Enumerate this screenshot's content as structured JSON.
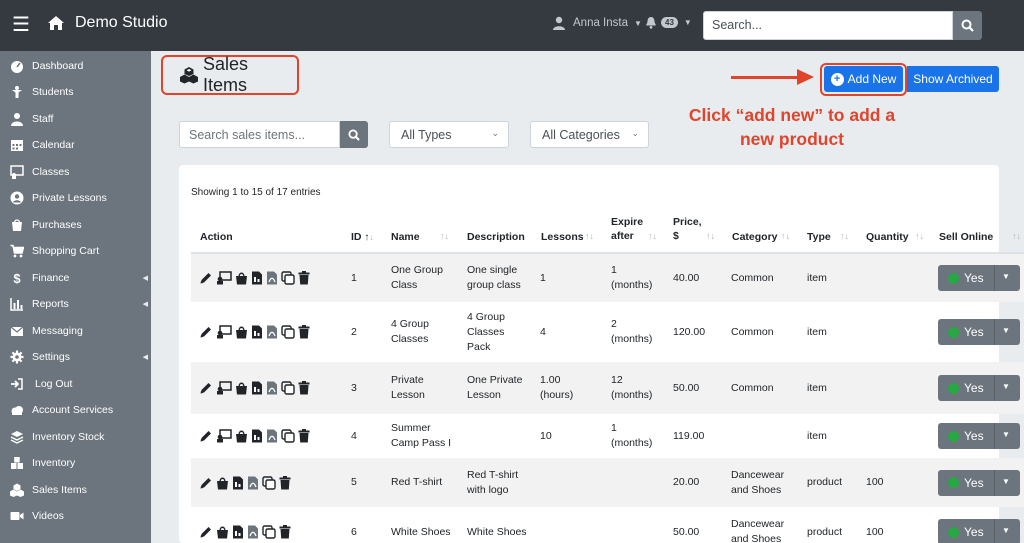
{
  "topbar": {
    "brand": "Demo Studio",
    "user_name": "Anna Insta",
    "notification_count": "43",
    "search_placeholder": "Search..."
  },
  "sidebar": {
    "items": [
      {
        "label": "Dashboard",
        "icon": "dashboard-icon"
      },
      {
        "label": "Students",
        "icon": "student-icon"
      },
      {
        "label": "Staff",
        "icon": "staff-icon"
      },
      {
        "label": "Calendar",
        "icon": "calendar-icon"
      },
      {
        "label": "Classes",
        "icon": "classes-icon"
      },
      {
        "label": "Private Lessons",
        "icon": "user-circle-icon"
      },
      {
        "label": "Purchases",
        "icon": "purchases-icon"
      },
      {
        "label": "Shopping Cart",
        "icon": "cart-icon"
      },
      {
        "label": "Finance",
        "icon": "dollar-icon"
      },
      {
        "label": "Reports",
        "icon": "reports-icon"
      },
      {
        "label": "Messaging",
        "icon": "envelope-icon"
      },
      {
        "label": "Settings",
        "icon": "gear-icon"
      },
      {
        "label": "Log Out",
        "icon": "logout-icon"
      },
      {
        "label": "Account Services",
        "icon": "cloud-icon"
      },
      {
        "label": "Inventory Stock",
        "icon": "layers-icon"
      },
      {
        "label": "Inventory",
        "icon": "inventory-icon"
      },
      {
        "label": "Sales Items",
        "icon": "cubes-icon"
      },
      {
        "label": "Videos",
        "icon": "video-icon"
      }
    ]
  },
  "page": {
    "title": "Sales Items",
    "add_new": "Add New",
    "show_archived": "Show Archived",
    "callout": "Click “add new” to add a new product",
    "search_placeholder": "Search sales items...",
    "type_select": "All Types",
    "category_select": "All Categories",
    "showing": "Showing 1 to 15 of 17 entries"
  },
  "table": {
    "headers": {
      "action": "Action",
      "id": "ID",
      "name": "Name",
      "description": "Description",
      "lessons": "Lessons",
      "expire_after": "Expire after",
      "price": "Price, $",
      "category": "Category",
      "type": "Type",
      "quantity": "Quantity",
      "sell_online": "Sell Online"
    },
    "rows": [
      {
        "id": "1",
        "name": "One Group Class",
        "description": "One single group class",
        "lessons": "1",
        "expire": "1 (months)",
        "price": "40.00",
        "category": "Common",
        "type": "item",
        "quantity": "",
        "sell": "Yes"
      },
      {
        "id": "2",
        "name": "4 Group Classes",
        "description": "4 Group Classes Pack",
        "lessons": "4",
        "expire": "2 (months)",
        "price": "120.00",
        "category": "Common",
        "type": "item",
        "quantity": "",
        "sell": "Yes"
      },
      {
        "id": "3",
        "name": "Private Lesson",
        "description": "One Private Lesson",
        "lessons": "1.00 (hours)",
        "expire": "12 (months)",
        "price": "50.00",
        "category": "Common",
        "type": "item",
        "quantity": "",
        "sell": "Yes"
      },
      {
        "id": "4",
        "name": "Summer Camp Pass I",
        "description": "",
        "lessons": "10",
        "expire": "1 (months)",
        "price": "119.00",
        "category": "",
        "type": "item",
        "quantity": "",
        "sell": "Yes"
      },
      {
        "id": "5",
        "name": "Red T-shirt",
        "description": "Red T-shirt with logo",
        "lessons": "",
        "expire": "",
        "price": "20.00",
        "category": "Dancewear and Shoes",
        "type": "product",
        "quantity": "100",
        "sell": "Yes"
      },
      {
        "id": "6",
        "name": "White Shoes",
        "description": "White Shoes",
        "lessons": "",
        "expire": "",
        "price": "50.00",
        "category": "Dancewear and Shoes",
        "type": "product",
        "quantity": "100",
        "sell": "Yes"
      }
    ]
  },
  "colors": {
    "topbar": "#343a40",
    "sidebar": "#6c757d",
    "primary": "#1a73e8",
    "annotation": "#e0442c",
    "success": "#28a745"
  }
}
